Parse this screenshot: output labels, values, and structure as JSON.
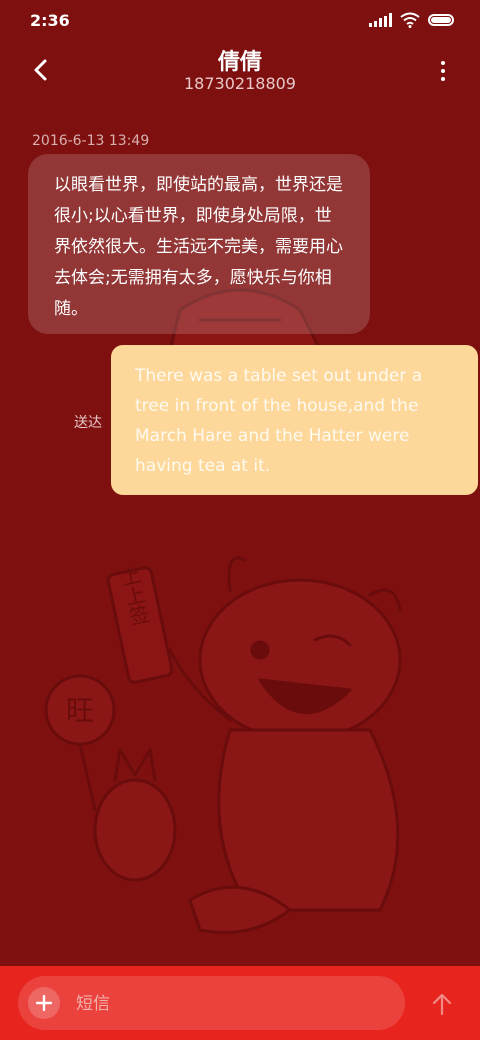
{
  "status_bar": {
    "time": "2:36"
  },
  "header": {
    "contact_name": "倩倩",
    "contact_number": "18730218809"
  },
  "thread": {
    "timestamp": "2016-6-13 13:49",
    "incoming_message": "以眼看世界，即使站的最高，世界还是很小;以心看世界，即使身处局限，世界依然很大。生活远不完美，需要用心去体会;无需拥有太多，愿快乐与你相随。",
    "delivery_status": "送达",
    "outgoing_message": "There was a table set out under a tree in front of the house,and the March Hare and the Hatter were having tea at it."
  },
  "background_art": {
    "sign_text": "上上签",
    "fan_text": "旺"
  },
  "compose": {
    "placeholder": "短信"
  },
  "colors": {
    "background": "#7e1010",
    "compose_bar": "#e8241e",
    "outgoing_bubble": "#fdd89a"
  },
  "icons": {
    "back": "chevron-left-icon",
    "menu": "more-vertical-icon",
    "add": "plus-icon",
    "send": "arrow-up-icon"
  }
}
